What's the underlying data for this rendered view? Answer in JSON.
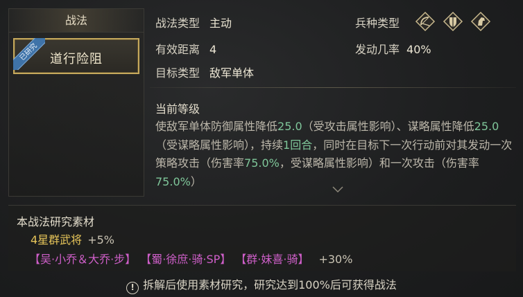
{
  "left_panel": {
    "title": "战法",
    "tactic_name": "道行险阻",
    "ribbon": "已研究"
  },
  "info": {
    "type_label": "战法类型",
    "type_value": "主动",
    "range_label": "有效距离",
    "range_value": "4",
    "target_label": "目标类型",
    "target_value": "敌军单体",
    "troop_label": "兵种类型",
    "trigger_label": "发动几率",
    "trigger_value": "40%",
    "troop_icons": [
      "bow-icon",
      "shield-icon",
      "cavalry-icon"
    ]
  },
  "level": {
    "title": "当前等级",
    "desc_parts": {
      "p1": "使敌军单体防御属性降低",
      "n1": "25.0",
      "p2": "（受攻击属性影响）、谋略属性降低",
      "n2": "25.0",
      "p3": "（受谋略属性影响），持续",
      "n3": "1回合",
      "p4": "，同时在目标下一次行动前对其发动一次策略攻击（伤害率",
      "n4": "75.0%",
      "p5": "，受谋略属性影响）和一次攻击（伤害率",
      "n5": "75.0%",
      "p6": "）"
    }
  },
  "materials": {
    "title": "本战法研究素材",
    "general": "4星群武将",
    "general_bonus": "+5%",
    "heroes": [
      "【吴·小乔＆大乔·步】",
      "【蜀·徐庶·骑·SP】",
      "【群·妹喜·骑】"
    ],
    "heroes_bonus": "+30%"
  },
  "notice": {
    "icon": "!",
    "text": "拆解后使用素材研究，研究达到100%后可获得战法"
  },
  "colors": {
    "highlight_number": "#7fc79a",
    "hero_name": "#cf5fc9",
    "general_name": "#e8c65a",
    "card_border": "#c6a95c"
  }
}
